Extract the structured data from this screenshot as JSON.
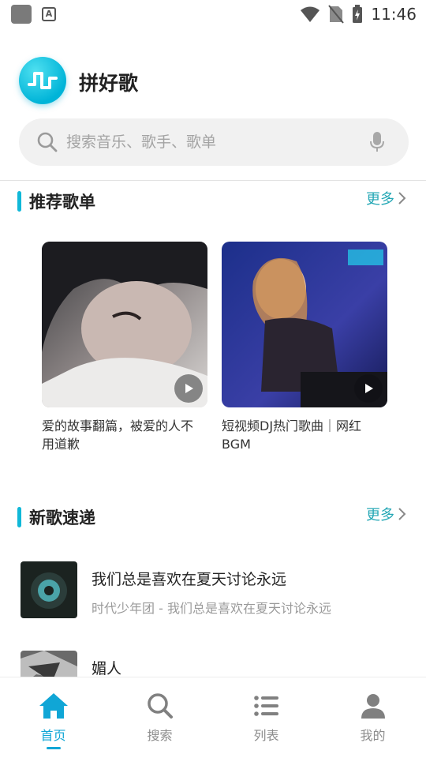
{
  "status_bar": {
    "time": "11:46",
    "a_label": "A"
  },
  "app": {
    "title": "拼好歌"
  },
  "search": {
    "placeholder": "搜索音乐、歌手、歌单"
  },
  "sections": {
    "recommended": {
      "title": "推荐歌单",
      "more": "更多"
    },
    "new_songs": {
      "title": "新歌速递",
      "more": "更多"
    }
  },
  "playlists": [
    {
      "title": "爱的故事翻篇，被爱的人不用道歉"
    },
    {
      "title": "短视频DJ热门歌曲｜网红BGM"
    }
  ],
  "songs": [
    {
      "title": "我们总是喜欢在夏天讨论永远",
      "subtitle": "时代少年团 - 我们总是喜欢在夏天讨论永远"
    },
    {
      "title": "媚人",
      "subtitle": ""
    }
  ],
  "nav": [
    {
      "label": "首页",
      "icon": "home-icon",
      "active": true
    },
    {
      "label": "搜索",
      "icon": "search-icon",
      "active": false
    },
    {
      "label": "列表",
      "icon": "list-icon",
      "active": false
    },
    {
      "label": "我的",
      "icon": "user-icon",
      "active": false
    }
  ],
  "colors": {
    "accent": "#10b8d8",
    "more_link": "#24a7b5",
    "nav_active": "#10a6d6"
  }
}
